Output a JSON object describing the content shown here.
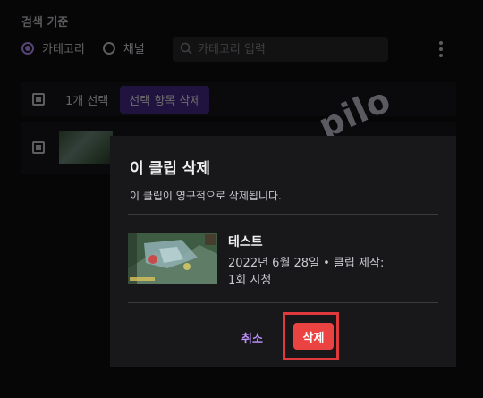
{
  "filter": {
    "title": "검색 기준",
    "options": [
      {
        "label": "카테고리",
        "selected": true
      },
      {
        "label": "채널",
        "selected": false
      }
    ],
    "search_placeholder": "카테고리 입력"
  },
  "toolbar": {
    "selected_count": "1개 선택",
    "delete_selected_label": "선택 항목 삭제"
  },
  "watermark": "pilo",
  "modal": {
    "title": "이 클립 삭제",
    "description": "이 클립이 영구적으로 삭제됩니다.",
    "clip": {
      "title": "테스트",
      "meta": "2022년 6월 28일 • 클립 제작:",
      "views": "1회 시청"
    },
    "cancel_label": "취소",
    "confirm_label": "삭제"
  },
  "colors": {
    "accent": "#bf94ff",
    "danger": "#eb4242",
    "highlight": "#e0393e",
    "modal_bg": "#18181b"
  }
}
